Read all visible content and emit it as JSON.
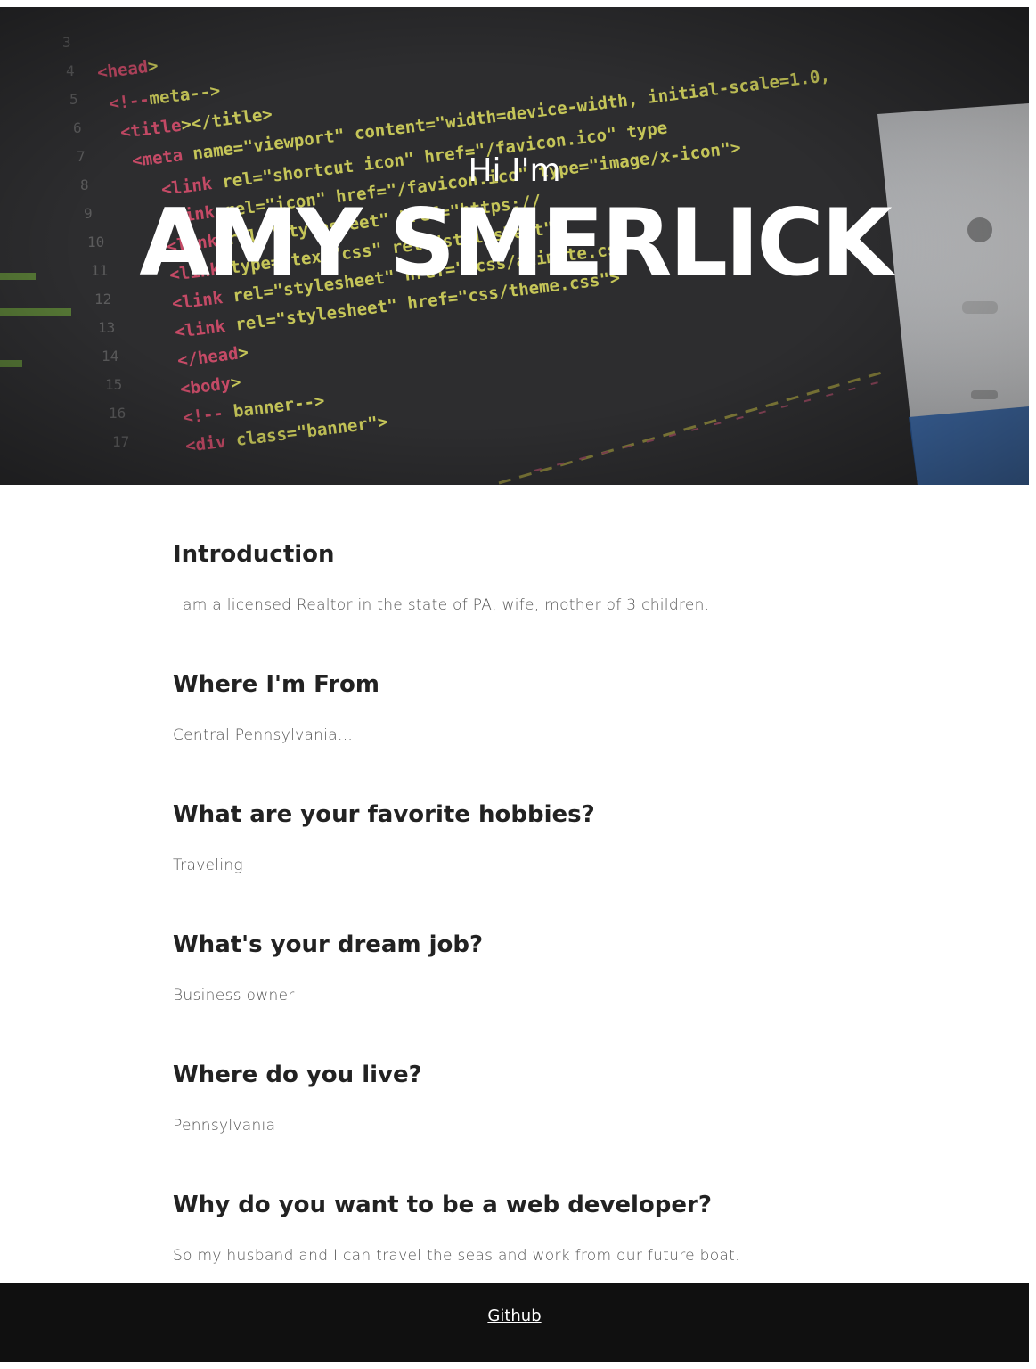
{
  "hero": {
    "greeting": "Hi I'm",
    "name": "AMY SMERLICK",
    "background_code_lines": [
      "<head>",
      "<!--meta-->",
      "<title></title>",
      "<meta name=\"viewport\" content=\"width=device-width, initial-scale=1.0,",
      "<link rel=\"shortcut icon\" href=\"/favicon.ico\" type",
      "<link rel=\"icon\" href=\"/favicon.ico\" type=\"image/x-icon\">",
      "<link rel=\"stylesheet\" href=\"https://",
      "<link type=\"text/css\" rel=\"stylesheet\"",
      "<link rel=\"stylesheet\" href=\"/css/animate.css\">",
      "<link rel=\"stylesheet\" href=\"css/theme.css\">",
      "</head>",
      "<body>",
      "<!-- banner-->",
      "<div class=\"banner\">"
    ],
    "line_numbers": [
      "3",
      "4",
      "5",
      "6",
      "7",
      "8",
      "9",
      "10",
      "11",
      "12",
      "13",
      "14",
      "15",
      "16",
      "17"
    ]
  },
  "sections": [
    {
      "heading": "Introduction",
      "body": "I am a licensed Realtor in the state of PA, wife, mother of 3 children."
    },
    {
      "heading": "Where I'm From",
      "body": "Central Pennsylvania..."
    },
    {
      "heading": "What are your favorite hobbies?",
      "body": "Traveling"
    },
    {
      "heading": "What's your dream job?",
      "body": "Business owner"
    },
    {
      "heading": "Where do you live?",
      "body": "Pennsylvania"
    },
    {
      "heading": "Why do you want to be a web developer?",
      "body": "So my husband and I can travel the seas and work from our future boat."
    }
  ],
  "footer": {
    "link_label": "Github"
  },
  "colors": {
    "hero_bg": "#2b2b2c",
    "heading": "#222222",
    "body_text": "#555555",
    "footer_bg": "#101010",
    "code_tag": "#f0a040",
    "code_attr": "#e0e060",
    "code_keyword": "#e05070"
  }
}
